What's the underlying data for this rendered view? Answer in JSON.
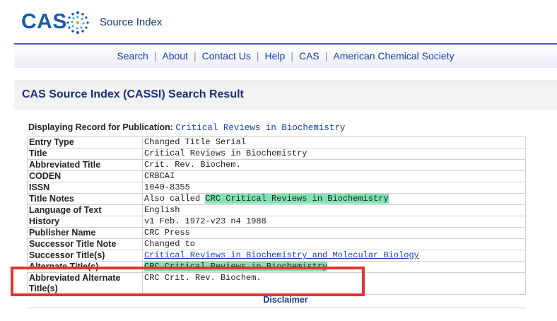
{
  "header": {
    "logo_text": "CAS",
    "logo_mark_icon": "cas-dots-logo-icon",
    "product_name": "Source Index"
  },
  "nav": {
    "items": [
      {
        "label": "Search"
      },
      {
        "label": "About"
      },
      {
        "label": "Contact Us"
      },
      {
        "label": "Help"
      },
      {
        "label": "CAS"
      },
      {
        "label": "American Chemical Society"
      }
    ],
    "separator": "|"
  },
  "panel": {
    "title": "CAS Source Index (CASSI) Search Result"
  },
  "record": {
    "display_label": "Displaying Record for Publication:",
    "publication": "Critical Reviews in Biochemistry",
    "rows": [
      {
        "label": "Entry Type",
        "value": "Changed Title Serial"
      },
      {
        "label": "Title",
        "value": "Critical Reviews in Biochemistry"
      },
      {
        "label": "Abbreviated Title",
        "value": "Crit. Rev. Biochem."
      },
      {
        "label": "CODEN",
        "value": "CRBCAI"
      },
      {
        "label": "ISSN",
        "value": "1040-8355"
      },
      {
        "label": "Title Notes",
        "value_prefix": "Also called ",
        "value_highlight": "CRC Critical Reviews in Biochemistry"
      },
      {
        "label": "Language of Text",
        "value": "English"
      },
      {
        "label": "History",
        "value": "v1 Feb. 1972-v23 n4 1988"
      },
      {
        "label": "Publisher Name",
        "value": "CRC Press"
      },
      {
        "label": "Successor Title Note",
        "value": "Changed to"
      },
      {
        "label": "Successor Title(s)",
        "value": "Critical Reviews in Biochemistry and Molecular Biology"
      },
      {
        "label": "Alternate Title(s)",
        "value": "CRC Critical Reviews in Biochemistry"
      },
      {
        "label": "Abbreviated Alternate Title(s)",
        "value": "CRC Crit. Rev. Biochem."
      }
    ]
  },
  "footer": {
    "disclaimer": "Disclaimer"
  },
  "colors": {
    "brand_blue": "#1b5aa6",
    "link_blue": "#1740b0",
    "highlight_green": "#7fe3b4",
    "annotation_red": "#e8322c"
  }
}
